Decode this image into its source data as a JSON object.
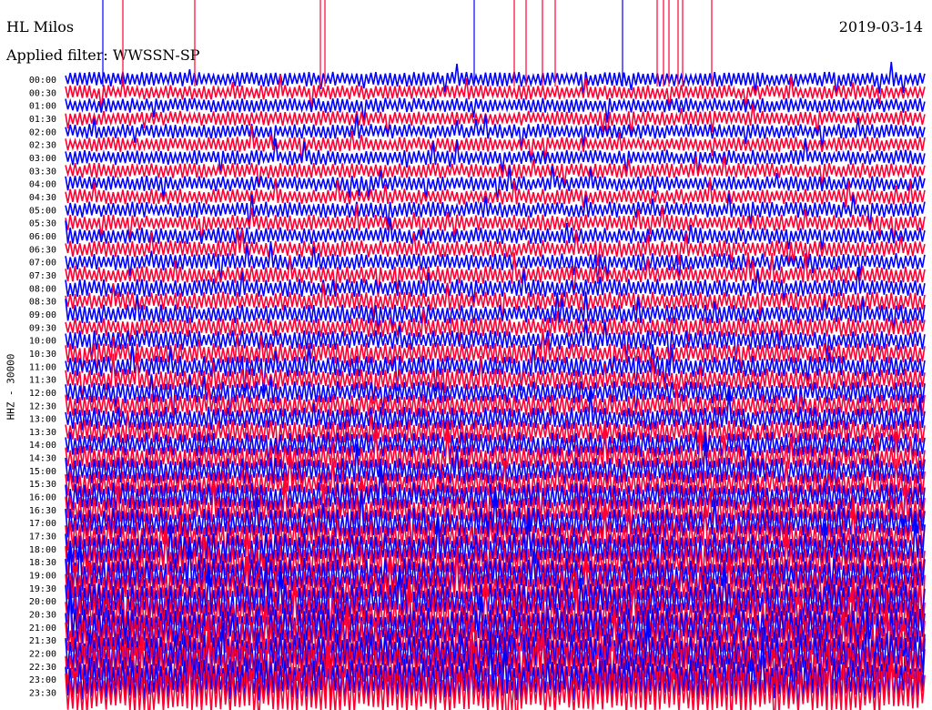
{
  "header": {
    "station": "HL Milos",
    "date": "2019-03-14",
    "filter": "Applied filter: WWSSN-SP"
  },
  "chart_data": {
    "type": "line",
    "title": "HL Milos",
    "ylabel": "HHZ - 30000",
    "row_labels": [
      "00:00",
      "00:30",
      "01:00",
      "01:30",
      "02:00",
      "02:30",
      "03:00",
      "03:30",
      "04:00",
      "04:30",
      "05:00",
      "05:30",
      "06:00",
      "06:30",
      "07:00",
      "07:30",
      "08:00",
      "08:30",
      "09:00",
      "09:30",
      "10:00",
      "10:30",
      "11:00",
      "11:30",
      "12:00",
      "12:30",
      "13:00",
      "13:30",
      "14:00",
      "14:30",
      "15:00",
      "15:30",
      "16:00",
      "16:30",
      "17:00",
      "17:30",
      "18:00",
      "18:30",
      "19:00",
      "19:30",
      "20:00",
      "20:30",
      "21:00",
      "21:30",
      "22:00",
      "22:30",
      "23:00",
      "23:30"
    ],
    "series_colors": [
      "#0000ff",
      "#ff0033"
    ]
  }
}
